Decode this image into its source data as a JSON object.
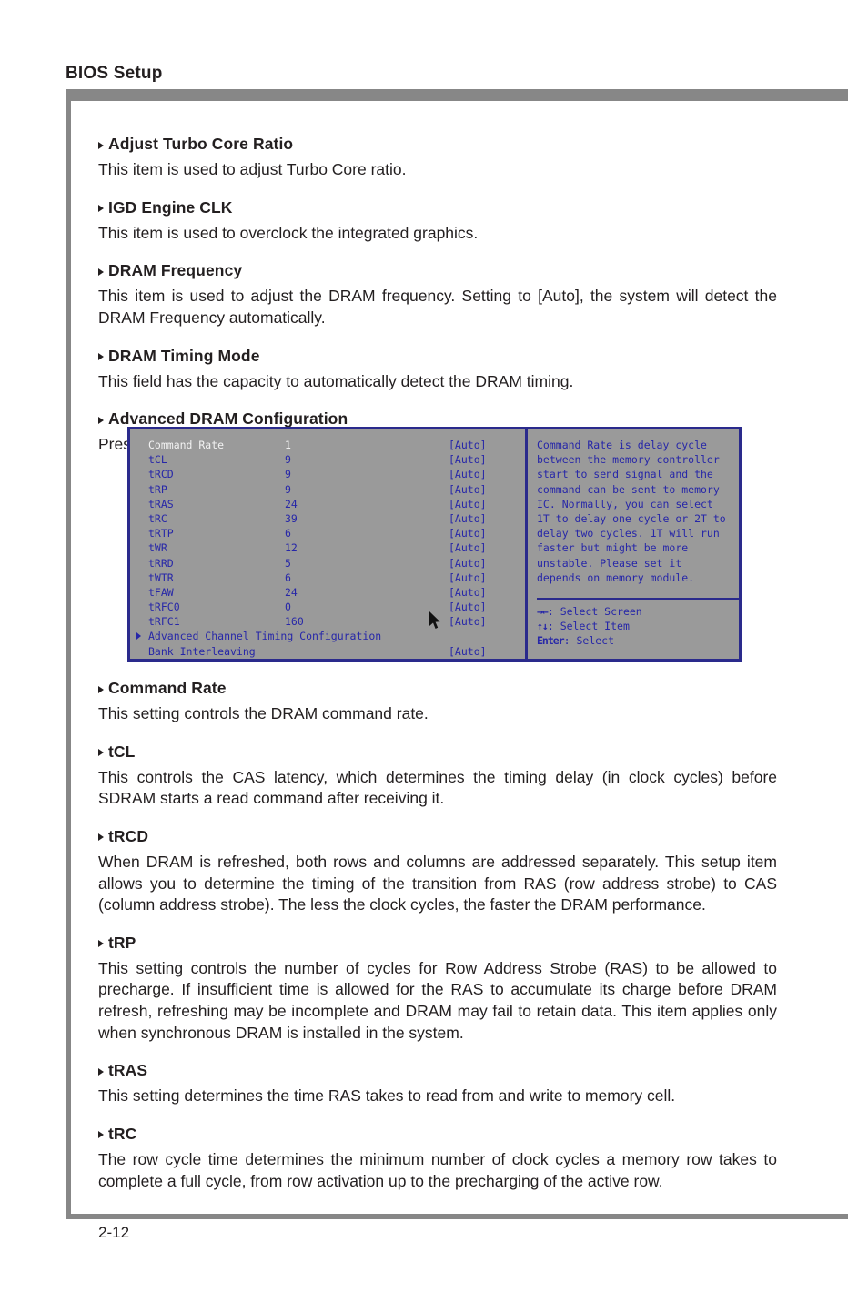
{
  "header": {
    "title": "BIOS Setup"
  },
  "footer": {
    "page_number": "2-12"
  },
  "sections_before": [
    {
      "heading": "Adjust Turbo Core Ratio",
      "body": "This item is used to adjust Turbo Core ratio."
    },
    {
      "heading": "IGD Engine CLK",
      "body": "This item is used to overclock the integrated graphics."
    },
    {
      "heading": "DRAM Frequency",
      "body": "This item is used to adjust the DRAM frequency. Setting to [Auto], the system will detect the DRAM Frequency automatically."
    },
    {
      "heading": "DRAM Timing Mode",
      "body": "This field has the capacity to automatically detect the DRAM timing."
    },
    {
      "heading": "Advanced DRAM Configuration",
      "body": "Press <Enter> to enter the sub-menu."
    }
  ],
  "bios_screen": {
    "rows": [
      {
        "name": "Command Rate",
        "value": "1",
        "setting": "[Auto]",
        "selected": true,
        "submenu": false
      },
      {
        "name": "tCL",
        "value": "9",
        "setting": "[Auto]",
        "selected": false,
        "submenu": false
      },
      {
        "name": "tRCD",
        "value": "9",
        "setting": "[Auto]",
        "selected": false,
        "submenu": false
      },
      {
        "name": "tRP",
        "value": "9",
        "setting": "[Auto]",
        "selected": false,
        "submenu": false
      },
      {
        "name": "tRAS",
        "value": "24",
        "setting": "[Auto]",
        "selected": false,
        "submenu": false
      },
      {
        "name": "tRC",
        "value": "39",
        "setting": "[Auto]",
        "selected": false,
        "submenu": false
      },
      {
        "name": "tRTP",
        "value": "6",
        "setting": "[Auto]",
        "selected": false,
        "submenu": false
      },
      {
        "name": "tWR",
        "value": "12",
        "setting": "[Auto]",
        "selected": false,
        "submenu": false
      },
      {
        "name": "tRRD",
        "value": "5",
        "setting": "[Auto]",
        "selected": false,
        "submenu": false
      },
      {
        "name": "tWTR",
        "value": "6",
        "setting": "[Auto]",
        "selected": false,
        "submenu": false
      },
      {
        "name": "tFAW",
        "value": "24",
        "setting": "[Auto]",
        "selected": false,
        "submenu": false
      },
      {
        "name": "tRFC0",
        "value": "0",
        "setting": "[Auto]",
        "selected": false,
        "submenu": false
      },
      {
        "name": "tRFC1",
        "value": "160",
        "setting": "[Auto]",
        "selected": false,
        "submenu": false
      },
      {
        "name": "Advanced Channel Timing Configuration",
        "value": "",
        "setting": "",
        "selected": false,
        "submenu": true
      },
      {
        "name": "Bank Interleaving",
        "value": "",
        "setting": "[Auto]",
        "selected": false,
        "submenu": false
      }
    ],
    "help_lines": [
      "Command Rate is delay cycle",
      "between the memory controller",
      "start to send signal and the",
      "command can be sent to memory",
      "IC. Normally, you can select",
      "1T to delay one cycle or 2T to",
      "delay two cycles. 1T will run",
      "faster but might be more",
      "unstable. Please set it",
      "depends on memory module."
    ],
    "key_legend": [
      {
        "glyph": "→←",
        "label": ": Select Screen"
      },
      {
        "glyph": "↑↓",
        "label": ": Select Item"
      },
      {
        "glyph": "Enter",
        "label": ": Select"
      }
    ],
    "colors": {
      "background": "#9a9a9a",
      "border": "#2a2a8c",
      "text": "#2727a8",
      "selected_text": "#f2f2f2"
    }
  },
  "sections_after": [
    {
      "heading": "Command Rate",
      "body": "This setting controls the DRAM command rate."
    },
    {
      "heading": "tCL",
      "body": "This controls the CAS latency, which determines the timing delay (in clock cycles) before SDRAM starts a read command after receiving it."
    },
    {
      "heading": "tRCD",
      "body": "When DRAM is refreshed, both rows and columns are addressed separately. This setup item allows you to determine the timing of the transition from RAS (row address strobe) to CAS (column address strobe). The less the clock cycles, the faster the DRAM performance."
    },
    {
      "heading": "tRP",
      "body": "This setting controls the number of cycles for Row Address Strobe (RAS) to be allowed to precharge. If insufficient time is allowed for the RAS to accumulate its charge before DRAM refresh, refreshing may be incomplete and DRAM may fail to retain data. This item applies only when synchronous DRAM is installed in the system."
    },
    {
      "heading": "tRAS",
      "body": "This setting determines the time RAS takes to read from and write to memory cell."
    },
    {
      "heading": "tRC",
      "body": "The row cycle time determines the minimum number of clock cycles a memory row takes to complete a full cycle, from row activation up to the precharging of the active row."
    }
  ]
}
